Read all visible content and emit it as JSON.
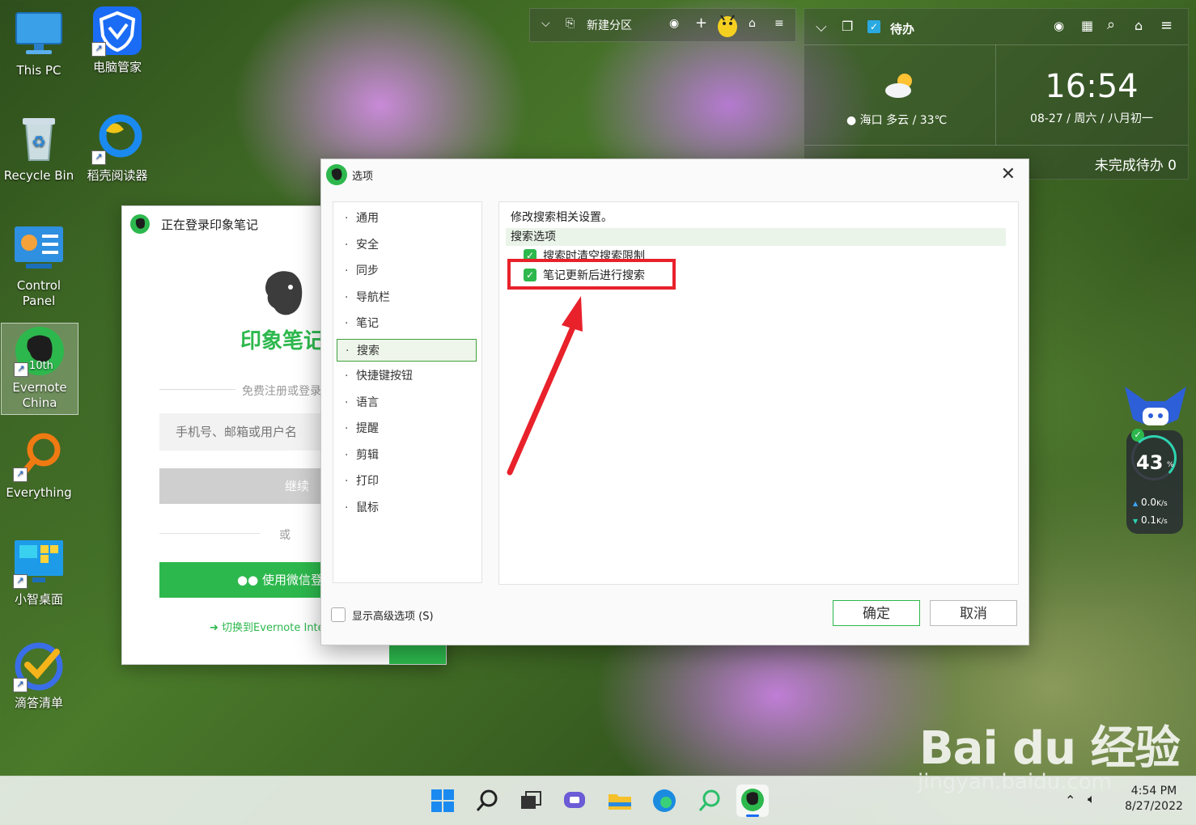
{
  "desktop_icons": {
    "this_pc": "This PC",
    "pc_manager": "电脑管家",
    "recycle_bin": "Recycle Bin",
    "docer_reader": "稻壳阅读器",
    "control_panel": "Control Panel",
    "evernote": "Evernote China",
    "everything": "Everything",
    "xiaozhi": "小智桌面",
    "dida": "滴答清单"
  },
  "top_bar": {
    "new_section": "新建分区"
  },
  "widget": {
    "todo_title": "待办",
    "weather": "海口  多云 / 33℃",
    "clock_time": "16:54",
    "clock_date": "08-27 / 周六 / 八月初一",
    "pending": "未完成待办 0"
  },
  "login_window": {
    "title": "正在登录印象笔记",
    "brand": "印象笔记",
    "register_hint": "免费注册或登录",
    "account_placeholder": "手机号、邮箱或用户名",
    "continue": "继续",
    "or": "或",
    "wechat_login": "使用微信登录",
    "switch_intl": "切换到Evernote International"
  },
  "dialog": {
    "title": "选项",
    "nav": [
      "通用",
      "安全",
      "同步",
      "导航栏",
      "笔记",
      "搜索",
      "快捷键按钮",
      "语言",
      "提醒",
      "剪辑",
      "打印",
      "鼠标"
    ],
    "active_index": 5,
    "description": "修改搜索相关设置。",
    "section": "搜索选项",
    "option1": "搜索时清空搜索限制",
    "option2": "笔记更新后进行搜索",
    "advanced": "显示高级选项 (S)",
    "ok": "确定",
    "cancel": "取消"
  },
  "net_monitor": {
    "cpu": "43",
    "cpu_unit": "%",
    "up": "0.0",
    "up_unit": "K/s",
    "down": "0.1",
    "down_unit": "K/s"
  },
  "taskbar": {
    "time": "4:54 PM",
    "date": "8/27/2022"
  },
  "watermark": {
    "brand": "Bai du 经验",
    "url": "jingyan.baidu.com"
  },
  "colors": {
    "accent_green": "#2db84d",
    "highlight_red": "#e8212b"
  }
}
